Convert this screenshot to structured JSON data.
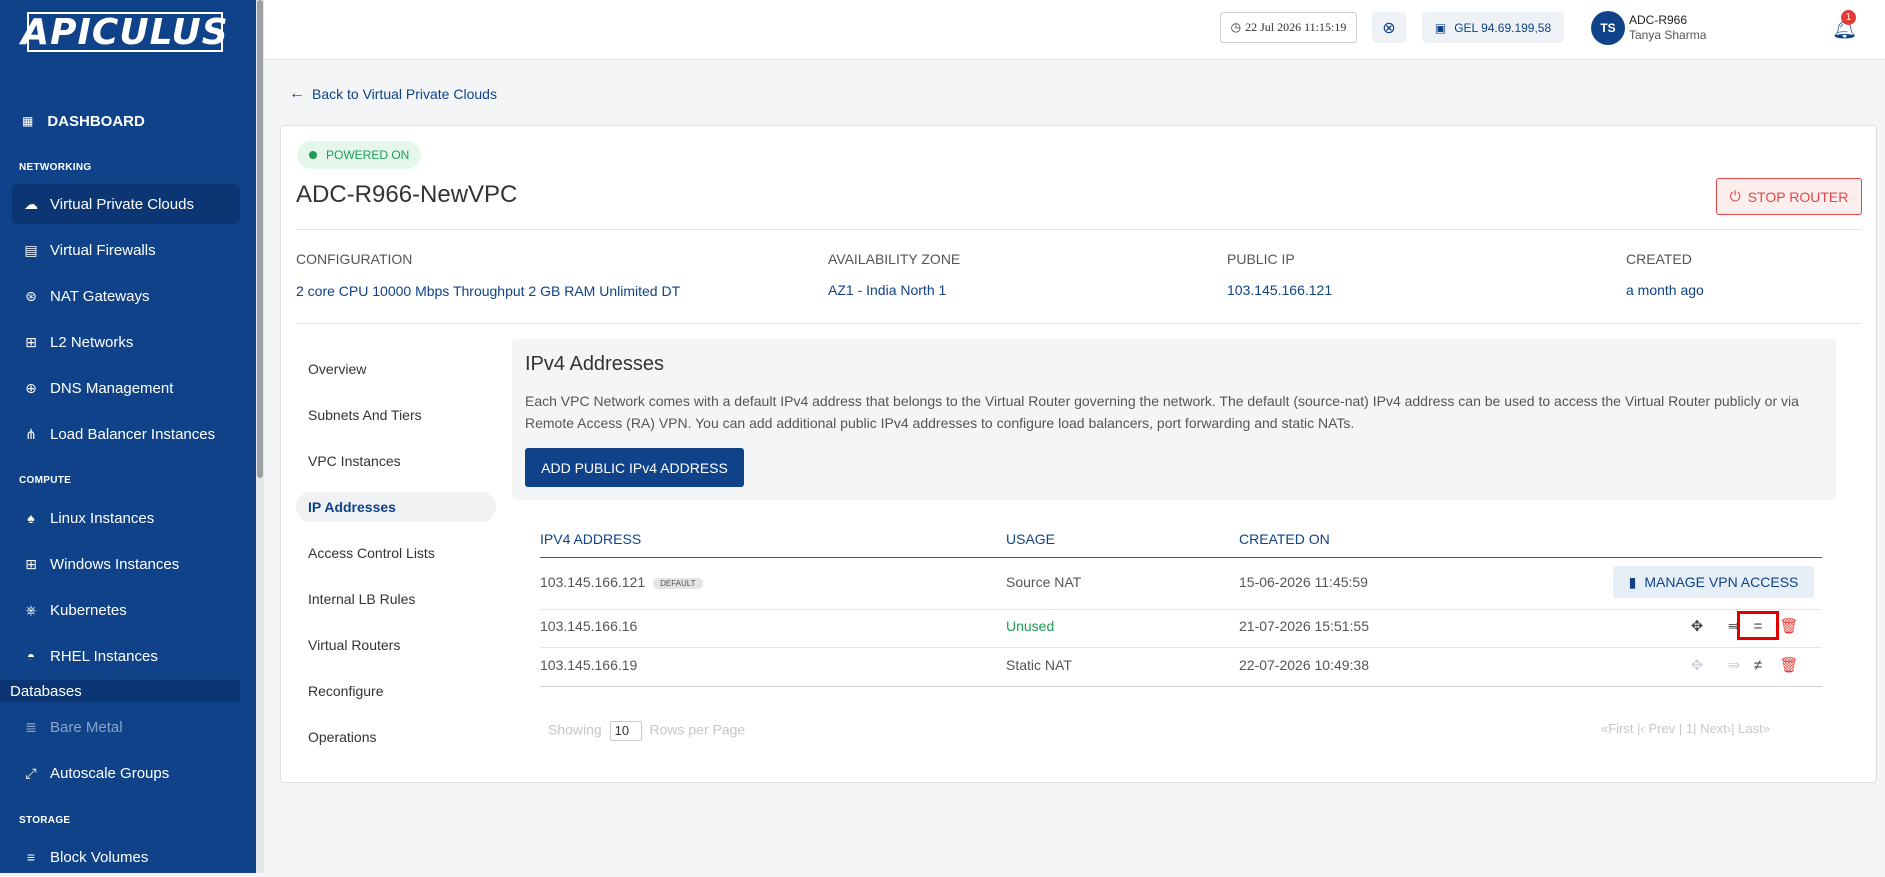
{
  "sidebar": {
    "logo": "APICULUS",
    "dashboard": "DASHBOARD",
    "sections": {
      "networking": "NETWORKING",
      "compute": "COMPUTE",
      "storage": "STORAGE"
    },
    "networking": [
      "Virtual Private Clouds",
      "Virtual Firewalls",
      "NAT Gateways",
      "L2 Networks",
      "DNS Management",
      "Load Balancer Instances"
    ],
    "compute": [
      "Linux Instances",
      "Windows Instances",
      "Kubernetes",
      "RHEL Instances"
    ],
    "databases": "Databases",
    "bare_metal": "Bare Metal",
    "autoscale": "Autoscale Groups",
    "storage": [
      "Block Volumes"
    ]
  },
  "header": {
    "datetime": "22 Jul 2026 11:15:19",
    "balance": "GEL 94.69.199,58",
    "avatar_initials": "TS",
    "account": "ADC-R966",
    "user_name": "Tanya Sharma",
    "notification_count": "1"
  },
  "page": {
    "back_link": "Back to Virtual Private Clouds",
    "status": "POWERED ON",
    "vpc_name": "ADC-R966-NewVPC",
    "stop_router": "STOP ROUTER",
    "info": {
      "configuration_label": "CONFIGURATION",
      "configuration_value": "2 core CPU 10000 Mbps Throughput 2 GB RAM Unlimited DT",
      "zone_label": "AVAILABILITY ZONE",
      "zone_value": "AZ1 - India North 1",
      "public_ip_label": "PUBLIC IP",
      "public_ip_value": "103.145.166.121",
      "created_label": "CREATED",
      "created_value": "a month ago"
    },
    "tabs": [
      "Overview",
      "Subnets And Tiers",
      "VPC Instances",
      "IP Addresses",
      "Access Control Lists",
      "Internal LB Rules",
      "Virtual Routers",
      "Reconfigure",
      "Operations"
    ],
    "active_tab": "IP Addresses"
  },
  "ipv4": {
    "title": "IPv4 Addresses",
    "description": "Each VPC Network comes with a default IPv4 address that belongs to the Virtual Router governing the network. The default (source-nat) IPv4 address can be used to access the Virtual Router publicly or via Remote Access (RA) VPN. You can add additional public IPv4 addresses to configure load balancers, port forwarding and static NATs.",
    "add_button": "ADD PUBLIC IPv4 ADDRESS",
    "columns": [
      "IPV4 ADDRESS",
      "USAGE",
      "CREATED ON"
    ],
    "rows": [
      {
        "ip": "103.145.166.121",
        "tag": "DEFAULT",
        "usage": "Source NAT",
        "created": "15-06-2026 11:45:59",
        "action": "MANAGE VPN ACCESS"
      },
      {
        "ip": "103.145.166.16",
        "usage": "Unused",
        "created": "21-07-2026 15:51:55"
      },
      {
        "ip": "103.145.166.19",
        "usage": "Static NAT",
        "created": "22-07-2026 10:49:38"
      }
    ],
    "pager": {
      "showing": "Showing",
      "rows_value": "10",
      "rows_per_page": "Rows per Page",
      "first": "«First",
      "prev": "|‹ Prev",
      "page_sep": "|",
      "page": "1|",
      "next": "Next›|",
      "last": "Last»"
    }
  },
  "colors": {
    "brand": "#0f4289",
    "success": "#1f9d55",
    "danger": "#e53935"
  }
}
